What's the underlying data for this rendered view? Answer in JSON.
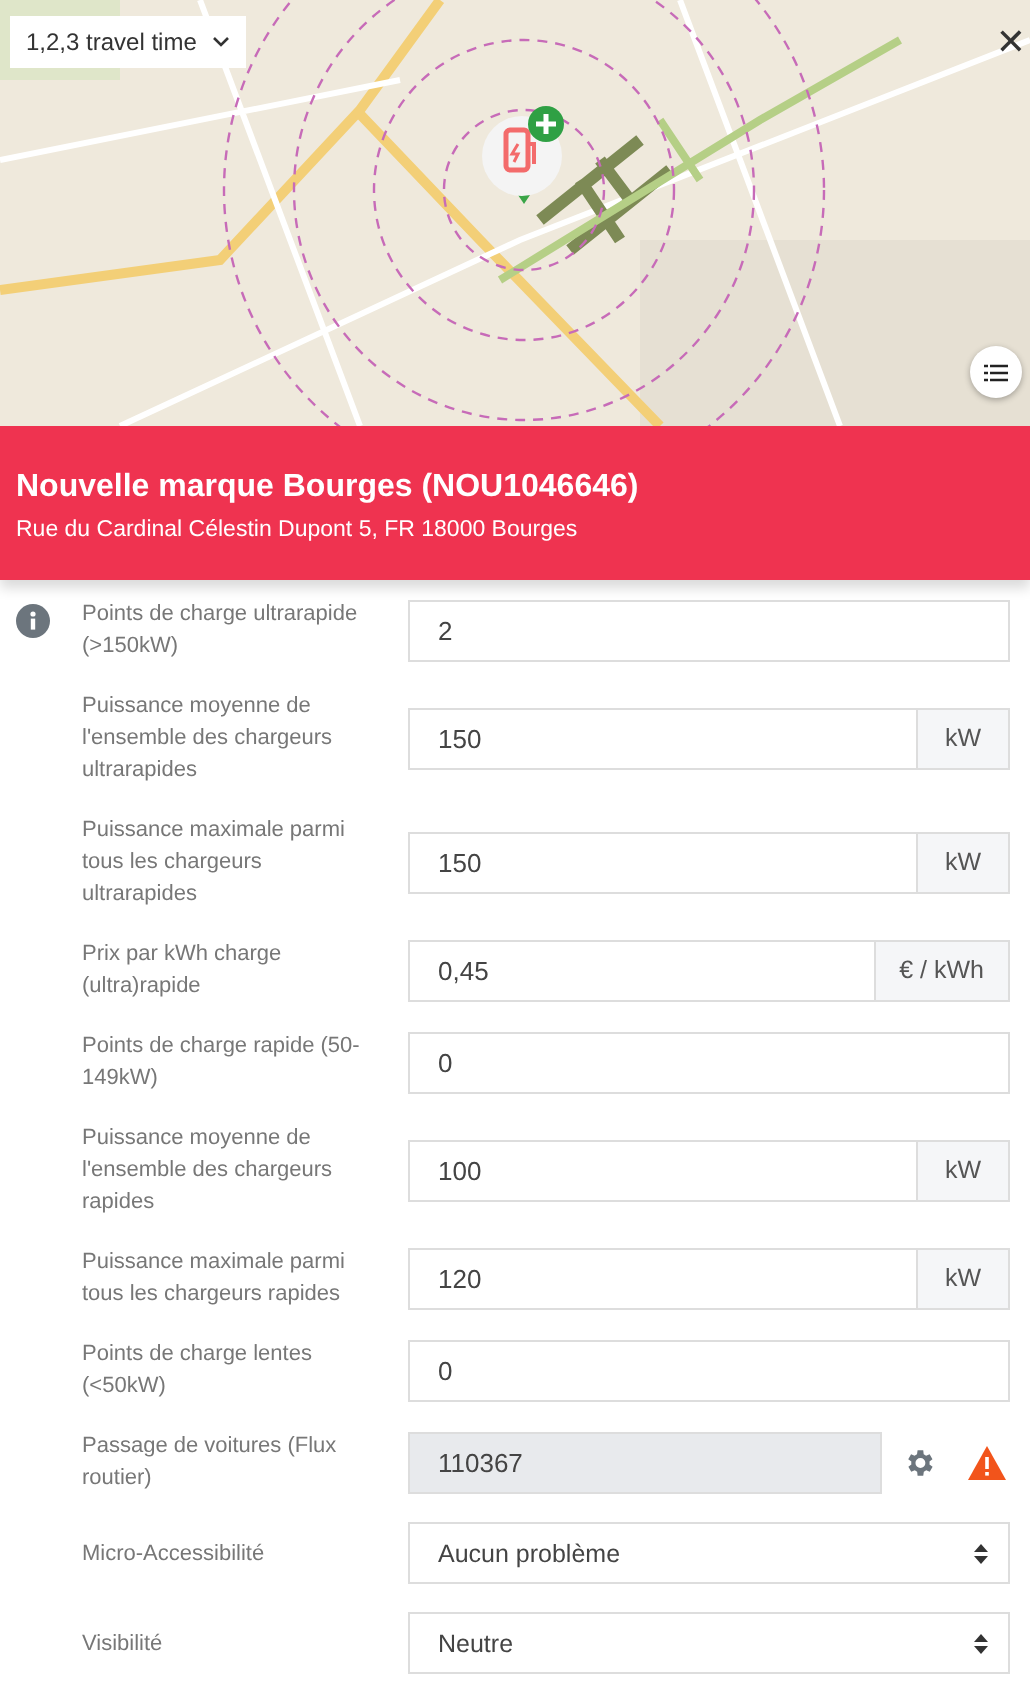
{
  "map": {
    "kind": "picture",
    "travel_select": {
      "value": "1,2,3 travel time"
    },
    "close": "✕"
  },
  "header": {
    "title": "Nouvelle marque Bourges (NOU1046646)",
    "address": "Rue du Cardinal Célestin Dupont 5, FR 18000 Bourges"
  },
  "fields": [
    {
      "kind": "text",
      "info": true,
      "label": "Points de charge ultrarapide (>150kW)",
      "value": "2"
    },
    {
      "kind": "unit",
      "info": false,
      "label": "Puissance moyenne de l'ensemble des chargeurs ultrarapides",
      "value": "150",
      "unit": "kW"
    },
    {
      "kind": "unit",
      "info": false,
      "label": "Puissance maximale parmi tous les chargeurs ultrarapides",
      "value": "150",
      "unit": "kW"
    },
    {
      "kind": "unit",
      "info": false,
      "label": "Prix par kWh charge (ultra)rapide",
      "value": "0,45",
      "unit": "€ / kWh"
    },
    {
      "kind": "text",
      "info": false,
      "label": "Points de charge rapide (50-149kW)",
      "value": "0"
    },
    {
      "kind": "unit",
      "info": false,
      "label": "Puissance moyenne de l'ensemble des chargeurs rapides",
      "value": "100",
      "unit": "kW"
    },
    {
      "kind": "unit",
      "info": false,
      "label": "Puissance maximale parmi tous les chargeurs rapides",
      "value": "120",
      "unit": "kW"
    },
    {
      "kind": "text",
      "info": false,
      "label": "Points de charge lentes (<50kW)",
      "value": "0"
    },
    {
      "kind": "readonly",
      "info": false,
      "label": "Passage de voitures (Flux routier)",
      "value": "110367",
      "warning": true
    },
    {
      "kind": "select",
      "info": false,
      "label": "Micro-Accessibilité",
      "value": "Aucun problème"
    },
    {
      "kind": "select",
      "info": false,
      "label": "Visibilité",
      "value": "Neutre"
    }
  ]
}
